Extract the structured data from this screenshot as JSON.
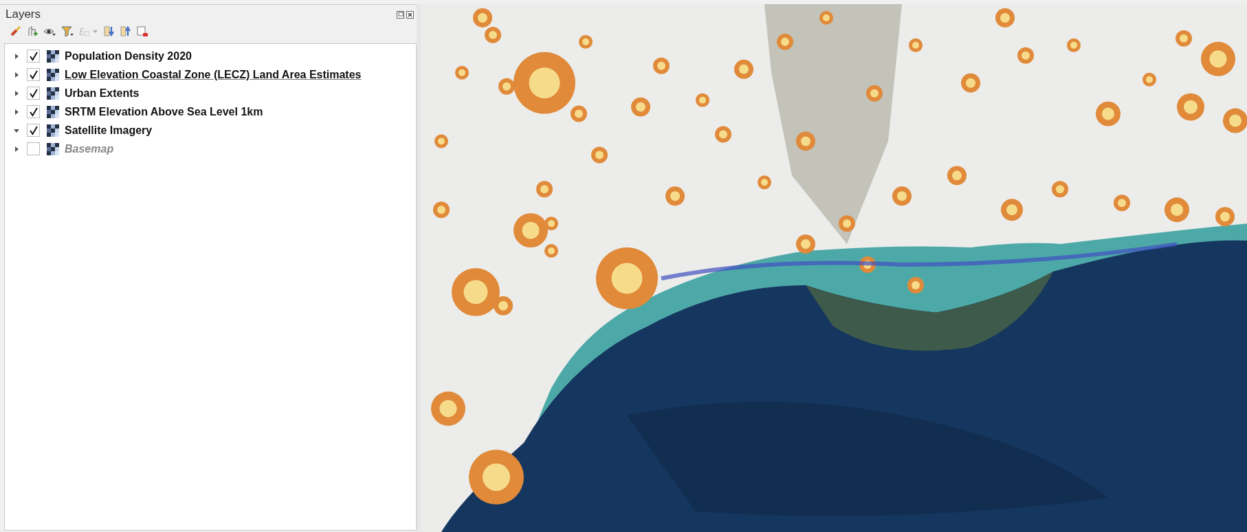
{
  "layers_panel": {
    "title": "Layers",
    "layers": [
      {
        "name": "Population Density 2020",
        "checked": true,
        "expanded": false,
        "highlighted": false,
        "disabled": false
      },
      {
        "name": "Low Elevation Coastal Zone (LECZ) Land Area Estimates",
        "checked": true,
        "expanded": false,
        "highlighted": true,
        "disabled": false
      },
      {
        "name": "Urban Extents",
        "checked": true,
        "expanded": false,
        "highlighted": false,
        "disabled": false
      },
      {
        "name": "SRTM Elevation Above Sea Level 1km",
        "checked": true,
        "expanded": false,
        "highlighted": false,
        "disabled": false
      },
      {
        "name": "Satellite Imagery",
        "checked": true,
        "expanded": true,
        "highlighted": false,
        "disabled": false
      },
      {
        "name": "Basemap",
        "checked": false,
        "expanded": false,
        "highlighted": false,
        "disabled": true
      }
    ]
  }
}
